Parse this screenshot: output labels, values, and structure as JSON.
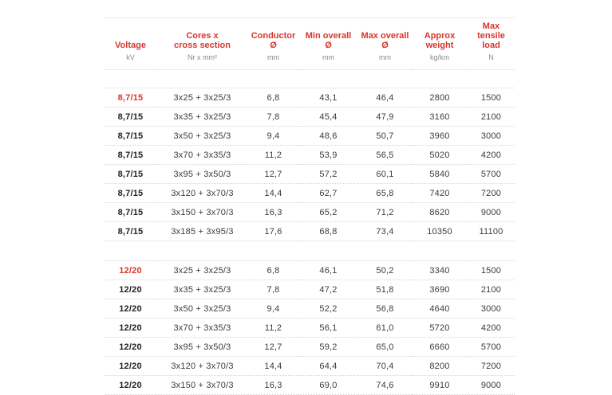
{
  "headers": {
    "voltage": "Voltage",
    "cores": "Cores x\ncross section",
    "conductor": "Conductor\nØ",
    "min_overall": "Min overall\nØ",
    "max_overall": "Max overall\nØ",
    "weight": "Approx\nweight",
    "tensile": "Max tensile\nload"
  },
  "units": {
    "voltage": "kV",
    "cores": "Nr x mm²",
    "conductor": "mm",
    "min_overall": "mm",
    "max_overall": "mm",
    "weight": "kg/km",
    "tensile": "N"
  },
  "colors": {
    "accent": "#d9352a",
    "text": "#3c3c3c",
    "unit_text": "#8a8a8a"
  },
  "groups": [
    {
      "rows": [
        {
          "voltage": "8,7/15",
          "cores": "3x25 + 3x25/3",
          "conductor": "6,8",
          "min_overall": "43,1",
          "max_overall": "46,4",
          "weight": "2800",
          "tensile": "1500"
        },
        {
          "voltage": "8,7/15",
          "cores": "3x35 + 3x25/3",
          "conductor": "7,8",
          "min_overall": "45,4",
          "max_overall": "47,9",
          "weight": "3160",
          "tensile": "2100"
        },
        {
          "voltage": "8,7/15",
          "cores": "3x50 + 3x25/3",
          "conductor": "9,4",
          "min_overall": "48,6",
          "max_overall": "50,7",
          "weight": "3960",
          "tensile": "3000"
        },
        {
          "voltage": "8,7/15",
          "cores": "3x70 + 3x35/3",
          "conductor": "11,2",
          "min_overall": "53,9",
          "max_overall": "56,5",
          "weight": "5020",
          "tensile": "4200"
        },
        {
          "voltage": "8,7/15",
          "cores": "3x95 + 3x50/3",
          "conductor": "12,7",
          "min_overall": "57,2",
          "max_overall": "60,1",
          "weight": "5840",
          "tensile": "5700"
        },
        {
          "voltage": "8,7/15",
          "cores": "3x120 + 3x70/3",
          "conductor": "14,4",
          "min_overall": "62,7",
          "max_overall": "65,8",
          "weight": "7420",
          "tensile": "7200"
        },
        {
          "voltage": "8,7/15",
          "cores": "3x150 + 3x70/3",
          "conductor": "16,3",
          "min_overall": "65,2",
          "max_overall": "71,2",
          "weight": "8620",
          "tensile": "9000"
        },
        {
          "voltage": "8,7/15",
          "cores": "3x185 + 3x95/3",
          "conductor": "17,6",
          "min_overall": "68,8",
          "max_overall": "73,4",
          "weight": "10350",
          "tensile": "11100"
        }
      ]
    },
    {
      "rows": [
        {
          "voltage": "12/20",
          "cores": "3x25 + 3x25/3",
          "conductor": "6,8",
          "min_overall": "46,1",
          "max_overall": "50,2",
          "weight": "3340",
          "tensile": "1500"
        },
        {
          "voltage": "12/20",
          "cores": "3x35 + 3x25/3",
          "conductor": "7,8",
          "min_overall": "47,2",
          "max_overall": "51,8",
          "weight": "3690",
          "tensile": "2100"
        },
        {
          "voltage": "12/20",
          "cores": "3x50 + 3x25/3",
          "conductor": "9,4",
          "min_overall": "52,2",
          "max_overall": "56,8",
          "weight": "4640",
          "tensile": "3000"
        },
        {
          "voltage": "12/20",
          "cores": "3x70 + 3x35/3",
          "conductor": "11,2",
          "min_overall": "56,1",
          "max_overall": "61,0",
          "weight": "5720",
          "tensile": "4200"
        },
        {
          "voltage": "12/20",
          "cores": "3x95 + 3x50/3",
          "conductor": "12,7",
          "min_overall": "59,2",
          "max_overall": "65,0",
          "weight": "6660",
          "tensile": "5700"
        },
        {
          "voltage": "12/20",
          "cores": "3x120 + 3x70/3",
          "conductor": "14,4",
          "min_overall": "64,4",
          "max_overall": "70,4",
          "weight": "8200",
          "tensile": "7200"
        },
        {
          "voltage": "12/20",
          "cores": "3x150 + 3x70/3",
          "conductor": "16,3",
          "min_overall": "69,0",
          "max_overall": "74,6",
          "weight": "9910",
          "tensile": "9000"
        }
      ]
    }
  ]
}
